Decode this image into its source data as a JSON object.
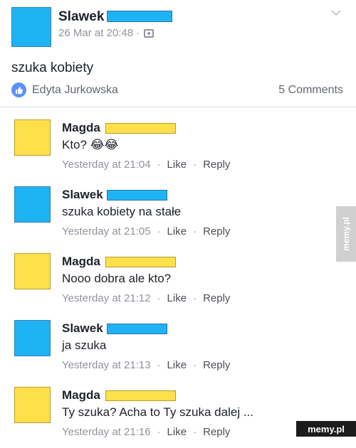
{
  "post": {
    "author": "Slawek",
    "meta": "26 Mar at 20:48 ·",
    "text": "szuka kobiety",
    "reaction_names": "Edyta Jurkowska",
    "comments_count": "5 Comments",
    "colors": {
      "avatar": "#1eb4f3",
      "like": "#5890ff"
    }
  },
  "comments": [
    {
      "author": "Magda",
      "text": "Kto? 😂😂",
      "time": "Yesterday at 21:04",
      "like": "Like",
      "reply": "Reply",
      "avatar_color": "#ffe04a"
    },
    {
      "author": "Slawek",
      "text": "szuka kobiety na stałe",
      "time": "Yesterday at 21:05",
      "like": "Like",
      "reply": "Reply",
      "avatar_color": "#1eb4f3"
    },
    {
      "author": "Magda",
      "text": "Nooo dobra ale kto?",
      "time": "Yesterday at 21:12",
      "like": "Like",
      "reply": "Reply",
      "avatar_color": "#ffe04a"
    },
    {
      "author": "Slawek",
      "text": "ja szuka",
      "time": "Yesterday at 21:13",
      "like": "Like",
      "reply": "Reply",
      "avatar_color": "#1eb4f3"
    },
    {
      "author": "Magda",
      "text": "Ty szuka? Acha to Ty szuka dalej ...",
      "time": "Yesterday at 21:16",
      "like": "Like",
      "reply": "Reply",
      "avatar_color": "#ffe04a"
    }
  ],
  "watermark": {
    "side": "memy.pl",
    "corner": "memy.pl"
  }
}
